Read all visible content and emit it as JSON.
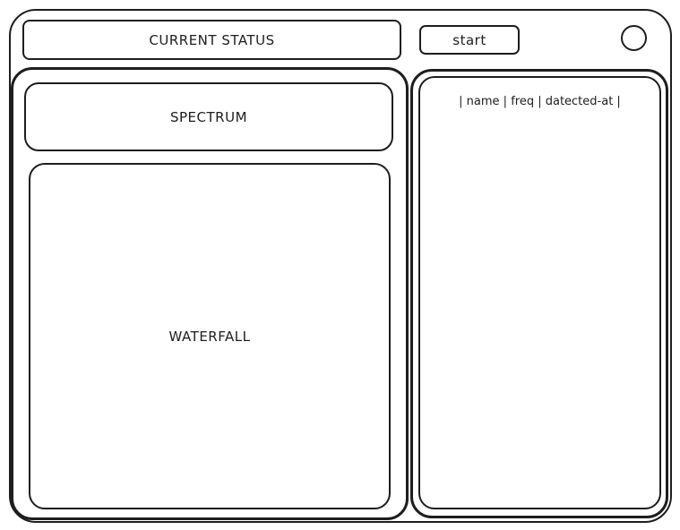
{
  "header": {
    "status_label": "CURRENT STATUS",
    "start_label": "start"
  },
  "left_panel": {
    "spectrum_label": "SPECTRUM",
    "waterfall_label": "WATERFALL"
  },
  "right_panel": {
    "table_header": "| name | freq | datected-at |"
  }
}
